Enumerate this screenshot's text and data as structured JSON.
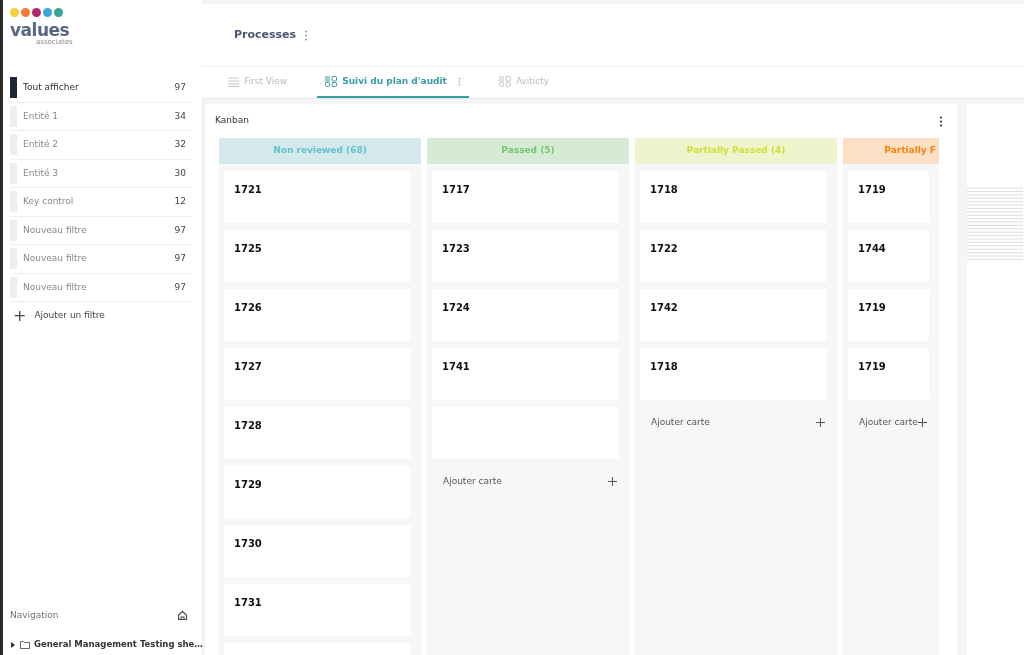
{
  "logo": {
    "text": "values",
    "subtext": "associates"
  },
  "filters": [
    {
      "label": "Tout afficher",
      "count": "97",
      "selected": true
    },
    {
      "label": "Entité 1",
      "count": "34",
      "selected": false
    },
    {
      "label": "Entité 2",
      "count": "32",
      "selected": false
    },
    {
      "label": "Entité 3",
      "count": "30",
      "selected": false
    },
    {
      "label": "Key control",
      "count": "12",
      "selected": false
    },
    {
      "label": "Nouveau filtre",
      "count": "97",
      "selected": false
    },
    {
      "label": "Nouveau filtre",
      "count": "97",
      "selected": false
    },
    {
      "label": "Nouveau filtre",
      "count": "97",
      "selected": false
    }
  ],
  "add_filter": {
    "icon": "+",
    "label": "Ajouter un filtre"
  },
  "navigation": {
    "title": "Navigation",
    "tree": [
      {
        "label": "General Management Testing she…",
        "expanded": false
      }
    ]
  },
  "page_title": "Processes",
  "tabs": [
    {
      "label": "First View",
      "kind": "list",
      "selected": false
    },
    {
      "label": "Suivi du plan d'audit",
      "kind": "board",
      "selected": true
    },
    {
      "label": "Aviticty",
      "kind": "board",
      "selected": false
    }
  ],
  "kanban": {
    "title": "Kanban",
    "columns": [
      {
        "title": "Non reviewed (68)",
        "color": "#d3e9ec",
        "cards": [
          {
            "title": "1721"
          },
          {
            "title": "1725"
          },
          {
            "title": "1726"
          },
          {
            "title": "1727"
          },
          {
            "title": "1728"
          },
          {
            "title": "1729"
          },
          {
            "title": "1730"
          },
          {
            "title": "1731"
          },
          {
            "kind": "empty"
          }
        ]
      },
      {
        "title": "Passed (5)",
        "color": "#d6ead5",
        "cards": [
          {
            "title": "1717"
          },
          {
            "title": "1723"
          },
          {
            "title": "1724"
          },
          {
            "title": "1741"
          },
          {
            "kind": "empty"
          }
        ],
        "add_label": "Ajouter carte"
      },
      {
        "title": "Partially Passed (4)",
        "color": "#eff4cc",
        "cards": [
          {
            "title": "1718"
          },
          {
            "title": "1722"
          },
          {
            "title": "1742"
          },
          {
            "title": "1718"
          }
        ],
        "add_label": "Ajouter carte"
      },
      {
        "title": "Partially F",
        "color": "#fde0c4",
        "cards": [
          {
            "title": "1719"
          },
          {
            "title": "1744"
          },
          {
            "title": "1719"
          },
          {
            "title": "1719"
          }
        ],
        "add_label": "Ajouter carte"
      }
    ]
  }
}
